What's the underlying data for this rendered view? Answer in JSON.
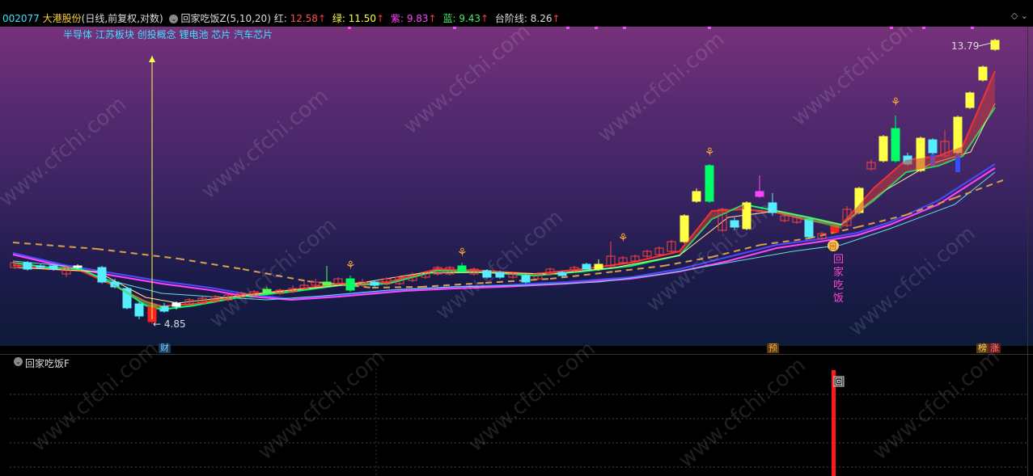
{
  "header": {
    "stock_code": "002077",
    "stock_name": "大港股份",
    "period": "(日线,前复权,对数)",
    "indicator": "回家吃饭Z(5,10,20)",
    "red_label": "红:",
    "red_value": "12.58",
    "green_label": "绿:",
    "green_value": "11.50",
    "purple_label": "紫:",
    "purple_value": "9.83",
    "blue_label": "蓝:",
    "blue_value": "9.43",
    "step_label": "台阶线:",
    "step_value": "8.26",
    "arrow": "↑",
    "right_icons": "◇ ⌄"
  },
  "concepts": "半导体 江苏板块 创投概念 锂电池 芯片 汽车芯片",
  "annotations": {
    "high": "13.79",
    "low": "4.85",
    "signal_text": [
      "回",
      "家",
      "吃",
      "饭"
    ],
    "signal_badge": "回",
    "sub_signal": "回"
  },
  "bottom_tags": {
    "cai": "财",
    "yu": "预",
    "bang": "榜",
    "zhang": "涨"
  },
  "sub_panel": {
    "title": "回家吃饭F"
  },
  "watermark": "www.cfchi.com",
  "colors": {
    "red": "#ff3030",
    "green": "#00ff66",
    "purple": "#ff44ff",
    "blue": "#4a4aff",
    "cyan_candle": "#55eeff",
    "step": "#d7a04a",
    "signal": "#ff1a1a"
  }
}
